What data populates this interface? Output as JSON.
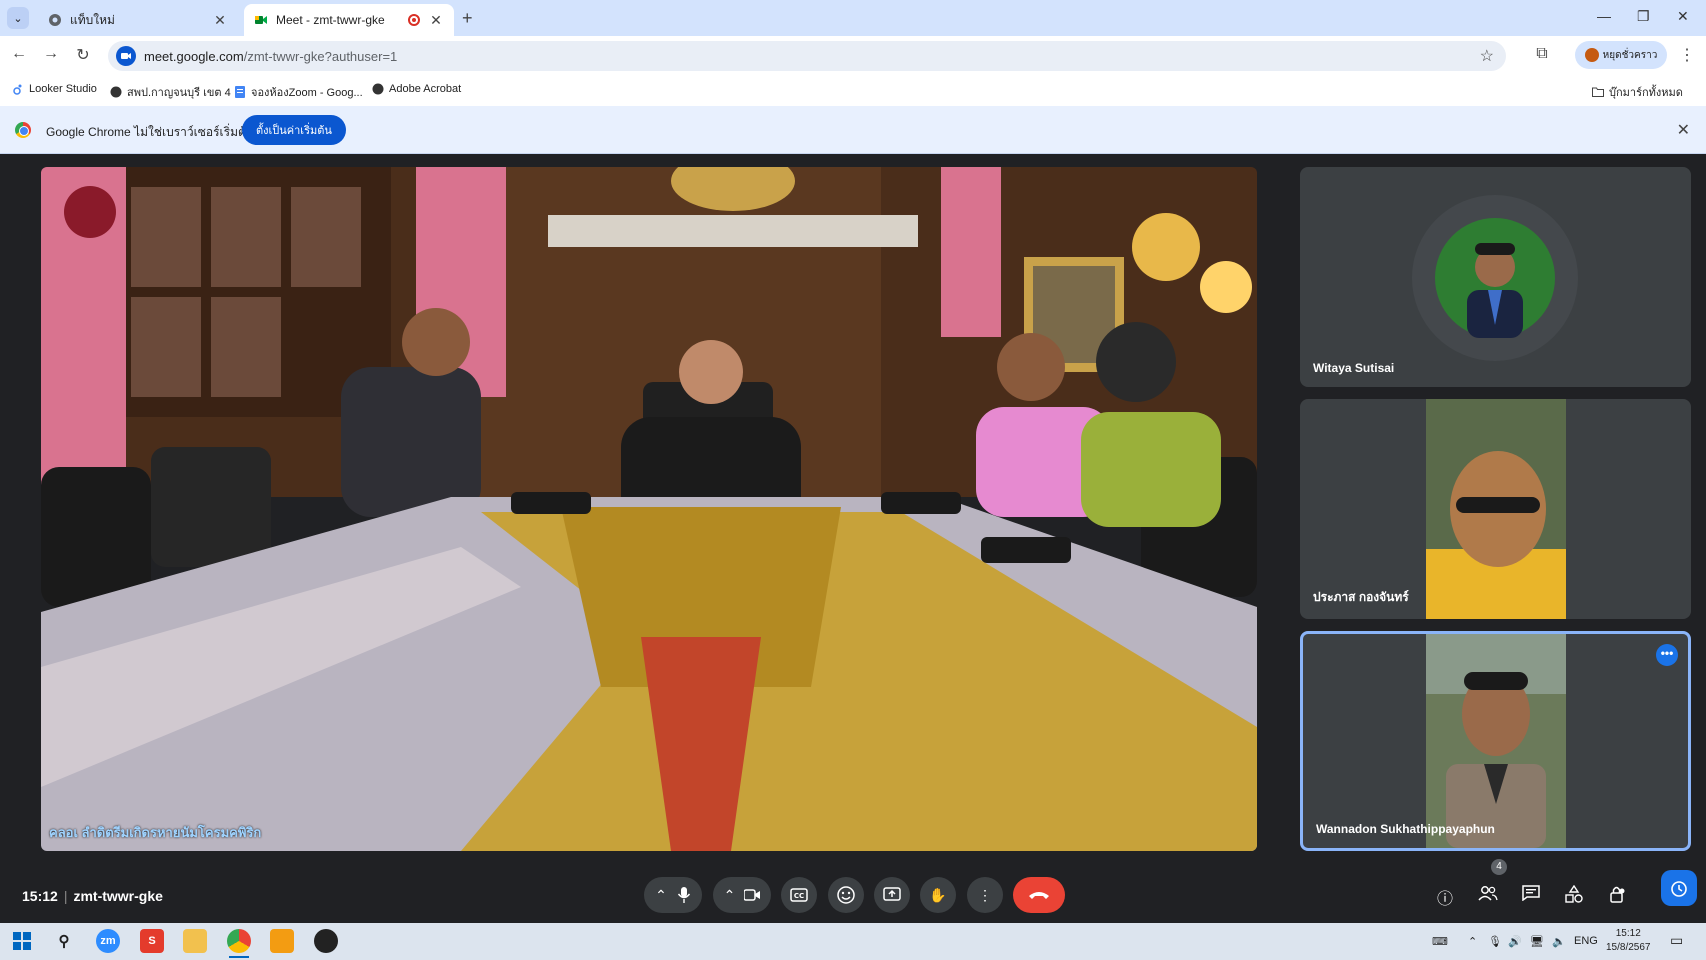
{
  "browser": {
    "tabs": [
      {
        "title": "แท็บใหม่",
        "active": false
      },
      {
        "title": "Meet - zmt-twwr-gke",
        "active": true,
        "recording": true
      }
    ],
    "new_tab": "+",
    "url_main": "meet.google.com",
    "url_rest": "/zmt-twwr-gke?authuser=1",
    "profile_label": "หยุดชั่วคราว",
    "bookmarks": [
      {
        "label": "Looker Studio"
      },
      {
        "label": "สพป.กาญจนบุรี เขต 4"
      },
      {
        "label": "จองห้องZoom - Goog..."
      },
      {
        "label": "Adobe Acrobat"
      }
    ],
    "all_bookmarks": "บุ๊กมาร์กทั้งหมด"
  },
  "infobar": {
    "text": "Google Chrome ไม่ใช่เบราว์เซอร์เริ่มต้น",
    "button": "ตั้งเป็นค่าเริ่มต้น"
  },
  "meet": {
    "main_caption": "คลอเ ลำดิตรีมเกิดรหายนัมโครมคพิริก",
    "participants": [
      {
        "name": "Witaya Sutisai",
        "camera": "off"
      },
      {
        "name": "ประภาส กองจันทร์",
        "camera": "on"
      },
      {
        "name": "Wannadon Sukhathippayaphun",
        "camera": "on",
        "highlighted": true
      }
    ],
    "time": "15:12",
    "meeting_code": "zmt-twwr-gke",
    "participant_count": "4"
  },
  "taskbar": {
    "lang": "ENG",
    "time": "15:12",
    "date": "15/8/2567"
  },
  "colors": {
    "meet_bg": "#202124",
    "hangup": "#ea4335",
    "accent_blue": "#1a73e8",
    "tab_strip": "#d3e3fd"
  }
}
